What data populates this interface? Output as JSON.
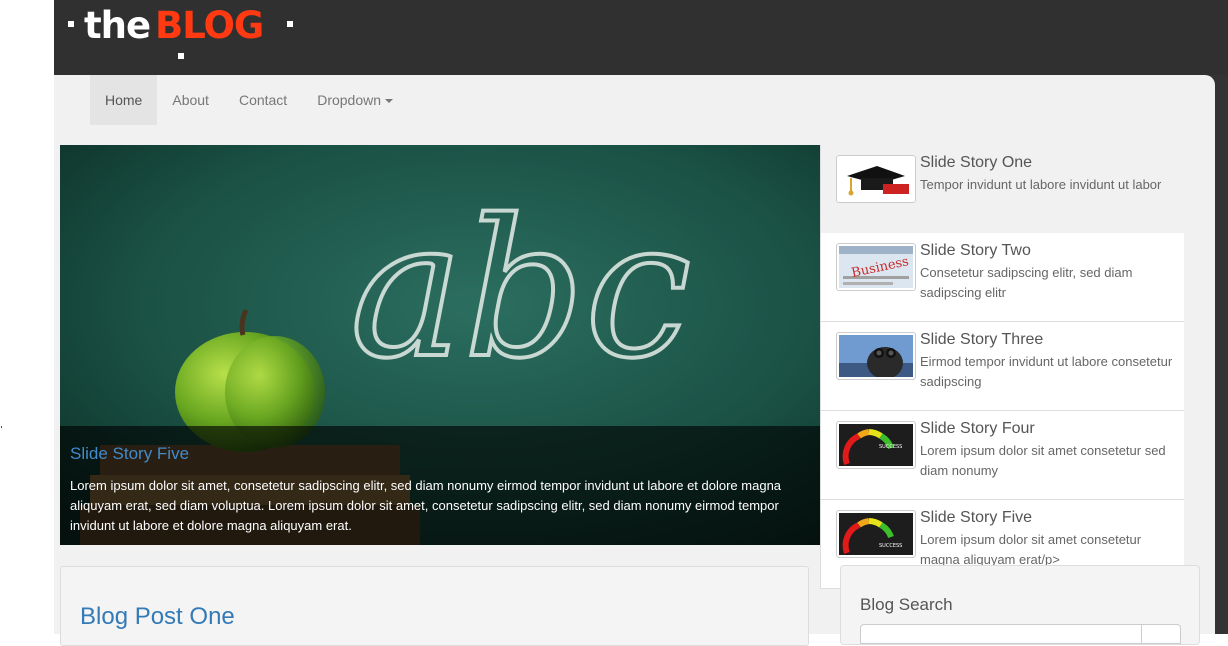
{
  "site": {
    "logo_the": "the",
    "logo_blog": "BLOG"
  },
  "nav": {
    "items": [
      {
        "label": "Home",
        "active": true
      },
      {
        "label": "About",
        "active": false
      },
      {
        "label": "Contact",
        "active": false
      },
      {
        "label": "Dropdown",
        "active": false,
        "has_caret": true
      }
    ]
  },
  "slider": {
    "chalk_text": "abc",
    "caption_title": "Slide Story Five",
    "caption_text": "Lorem ipsum dolor sit amet, consetetur sadipscing elitr, sed diam nonumy eirmod tempor invidunt ut labore et dolore magna aliquyam erat, sed diam voluptua. Lorem ipsum dolor sit amet, consetetur sadipscing elitr, sed diam nonumy eirmod tempor invidunt ut labore et dolore magna aliquyam erat."
  },
  "stories": [
    {
      "title": "Slide Story One",
      "text": "Tempor invidunt ut labore invidunt ut labor",
      "icon": "graduation-cap-icon",
      "active": true
    },
    {
      "title": "Slide Story Two",
      "text": "Consetetur sadipscing elitr, sed diam sadipscing elitr",
      "icon": "business-newspaper-icon",
      "active": false
    },
    {
      "title": "Slide Story Three",
      "text": "Eirmod tempor invidunt ut labore consetetur sadipscing",
      "icon": "binoculars-man-icon",
      "active": false
    },
    {
      "title": "Slide Story Four",
      "text": "Lorem ipsum dolor sit amet consetetur sed diam nonumy",
      "icon": "success-gauge-icon",
      "active": false
    },
    {
      "title": "Slide Story Five",
      "text": "Lorem ipsum dolor sit amet consetetur magna aliquyam erat/p>",
      "icon": "success-gauge-icon",
      "active": false
    }
  ],
  "thumb_labels": {
    "business": "Business",
    "success": "SUCCESS"
  },
  "post": {
    "title": "Blog Post One"
  },
  "sidebar": {
    "search_title": "Blog Search",
    "search_placeholder": ""
  },
  "colors": {
    "header_bg": "#303030",
    "brand_red": "#ff3a12",
    "link_blue": "#337ab7",
    "caption_title_blue": "#428bca",
    "content_bg": "#f1f1f1"
  }
}
